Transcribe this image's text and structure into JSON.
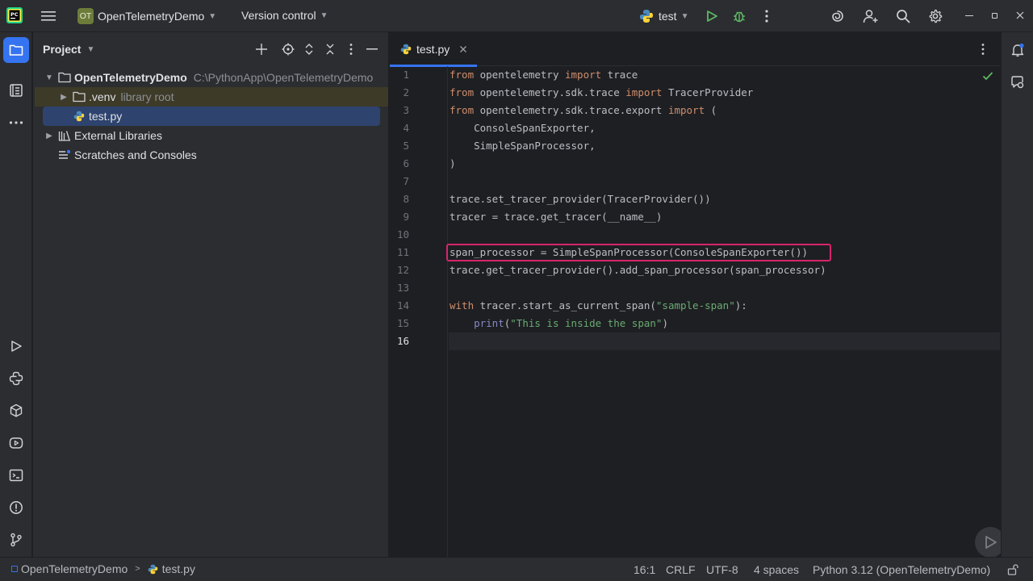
{
  "titlebar": {
    "project_badge": "OT",
    "project_name": "OpenTelemetryDemo",
    "vcs": "Version control",
    "run_config": "test"
  },
  "project_panel": {
    "title": "Project",
    "tree": [
      {
        "label": "OpenTelemetryDemo",
        "path": "C:\\PythonApp\\OpenTelemetryDemo"
      },
      {
        "label": ".venv",
        "note": "library root"
      },
      {
        "label": "test.py"
      },
      {
        "label": "External Libraries"
      },
      {
        "label": "Scratches and Consoles"
      }
    ]
  },
  "editor": {
    "tab_label": "test.py",
    "line_numbers": [
      "1",
      "2",
      "3",
      "4",
      "5",
      "6",
      "7",
      "8",
      "9",
      "10",
      "11",
      "12",
      "13",
      "14",
      "15",
      "16"
    ],
    "lines": [
      {
        "t1": "from",
        "t2": " opentelemetry ",
        "t3": "import",
        "t4": " trace"
      },
      {
        "t1": "from",
        "t2": " opentelemetry.sdk.trace ",
        "t3": "import",
        "t4": " TracerProvider"
      },
      {
        "t1": "from",
        "t2": " opentelemetry.sdk.trace.export ",
        "t3": "import",
        "t4": " ("
      },
      {
        "text": "    ConsoleSpanExporter,"
      },
      {
        "text": "    SimpleSpanProcessor,"
      },
      {
        "text": ")"
      },
      {
        "text": ""
      },
      {
        "text": "trace.set_tracer_provider(TracerProvider())"
      },
      {
        "text": "tracer = trace.get_tracer(__name__)"
      },
      {
        "text": ""
      },
      {
        "text": "span_processor = SimpleSpanProcessor(ConsoleSpanExporter())"
      },
      {
        "text": "trace.get_tracer_provider().add_span_processor(span_processor)"
      },
      {
        "text": ""
      },
      {
        "a": "with",
        "b": " tracer.start_as_current_span(",
        "c": "\"sample-span\"",
        "d": "):"
      },
      {
        "a": "    ",
        "b": "print",
        "c": "(",
        "d": "\"This is inside the span\"",
        "e": ")"
      },
      {
        "text": ""
      }
    ]
  },
  "statusbar": {
    "breadcrumb_project": "OpenTelemetryDemo",
    "breadcrumb_file": "test.py",
    "position": "16:1",
    "line_sep": "CRLF",
    "encoding": "UTF-8",
    "indent": "4 spaces",
    "interpreter": "Python 3.12 (OpenTelemetryDemo)"
  },
  "colors": {
    "accent": "#3574f0",
    "highlight_box": "#d6256d",
    "keyword": "#cf8e6d",
    "string": "#6aab73",
    "run_green": "#5fb865"
  }
}
